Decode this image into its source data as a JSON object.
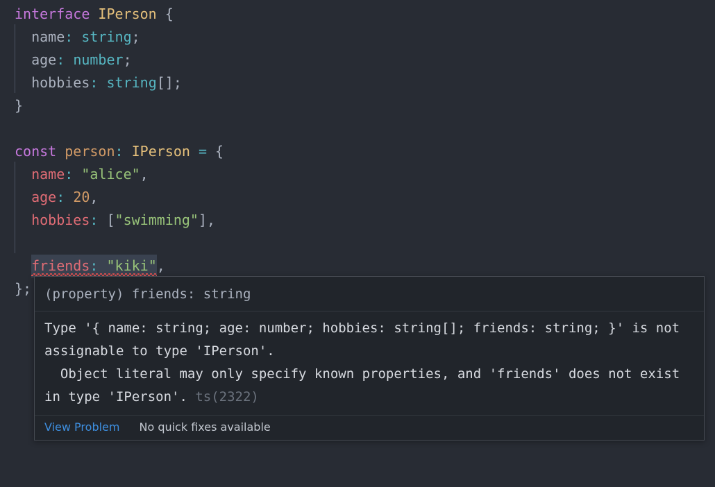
{
  "editor": {
    "theme_background": "#282c34",
    "language": "typescript",
    "lines": [
      {
        "n": 1,
        "text": "interface IPerson {"
      },
      {
        "n": 2,
        "text": "  name: string;"
      },
      {
        "n": 3,
        "text": "  age: number;"
      },
      {
        "n": 4,
        "text": "  hobbies: string[];"
      },
      {
        "n": 5,
        "text": "}"
      },
      {
        "n": 6,
        "text": ""
      },
      {
        "n": 7,
        "text": "const person: IPerson = {"
      },
      {
        "n": 8,
        "text": "  name: \"alice\","
      },
      {
        "n": 9,
        "text": "  age: 20,"
      },
      {
        "n": 10,
        "text": "  hobbies: [\"swimming\"],"
      },
      {
        "n": 11,
        "text": ""
      },
      {
        "n": 12,
        "text": "  friends: \"kiki\","
      },
      {
        "n": 13,
        "text": "};"
      }
    ],
    "tokens": {
      "kw_interface": "interface",
      "kw_const": "const",
      "type_iperson": "IPerson",
      "ident_person": "person",
      "prop_name": "name",
      "prop_age": "age",
      "prop_hobbies": "hobbies",
      "prop_friends": "friends",
      "prim_string": "string",
      "prim_number": "number",
      "prim_string_array": "string[]",
      "val_alice": "\"alice\"",
      "val_20": "20",
      "val_swimming": "\"swimming\"",
      "val_kiki": "\"kiki\"",
      "brace_open": "{",
      "brace_close": "}",
      "brace_close_semi": "};",
      "colon": ":",
      "semi": ";",
      "comma": ",",
      "equals": "=",
      "bracket_open": "[",
      "bracket_close": "]"
    },
    "colors": {
      "keyword": "#c678dd",
      "type": "#e5c07b",
      "identifier": "#d19a66",
      "object_key": "#e06c75",
      "primitive_type": "#56b6c2",
      "string": "#98c379",
      "number": "#d19a66",
      "punctuation": "#abb2bf",
      "error_squiggle": "#e05252",
      "hover_highlight": "#3a4250",
      "indent_guide": "#4b5263"
    }
  },
  "tooltip": {
    "header": "(property) friends: string",
    "message_line1": "Type '{ name: string; age: number; hobbies: string[]; friends: string; }' is not assignable to type 'IPerson'.",
    "message_line2": "  Object literal may only specify known properties, and 'friends' does not exist in type 'IPerson'.",
    "error_code": "ts(2322)",
    "view_problem_label": "View Problem",
    "quick_fix_label": "No quick fixes available",
    "link_color": "#3e8fe0",
    "background": "#21252b",
    "border_color": "#454a52"
  }
}
